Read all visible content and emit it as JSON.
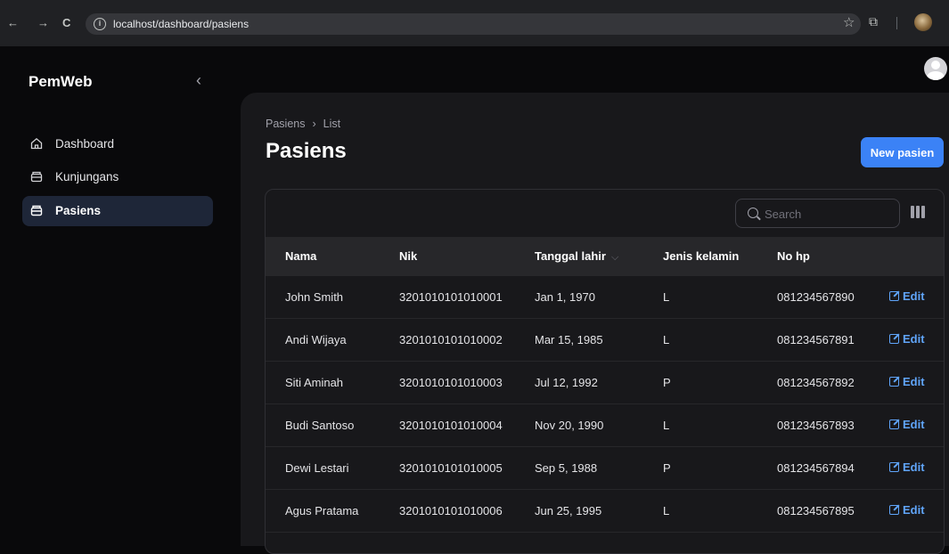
{
  "browser": {
    "back": "←",
    "forward": "→",
    "reload": "C",
    "url": "localhost/dashboard/pasiens"
  },
  "sidebar": {
    "brand": "PemWeb",
    "collapse_icon": "chevron-left-icon",
    "items": [
      {
        "label": "Dashboard",
        "icon": "home-icon",
        "active": false
      },
      {
        "label": "Kunjungans",
        "icon": "inbox-icon",
        "active": false
      },
      {
        "label": "Pasiens",
        "icon": "inbox-icon",
        "active": true
      }
    ]
  },
  "header": {
    "breadcrumb": [
      "Pasiens",
      "List"
    ],
    "title": "Pasiens",
    "new_button": "New pasien"
  },
  "table": {
    "search_placeholder": "Search",
    "columns": [
      "Nama",
      "Nik",
      "Tanggal lahir",
      "Jenis kelamin",
      "No hp"
    ],
    "sorted_column": "Tanggal lahir",
    "edit_label": "Edit",
    "rows": [
      [
        "John Smith",
        "3201010101010001",
        "Jan 1, 1970",
        "L",
        "081234567890"
      ],
      [
        "Andi Wijaya",
        "3201010101010002",
        "Mar 15, 1985",
        "L",
        "081234567891"
      ],
      [
        "Siti Aminah",
        "3201010101010003",
        "Jul 12, 1992",
        "P",
        "081234567892"
      ],
      [
        "Budi Santoso",
        "3201010101010004",
        "Nov 20, 1990",
        "L",
        "081234567893"
      ],
      [
        "Dewi Lestari",
        "3201010101010005",
        "Sep 5, 1988",
        "P",
        "081234567894"
      ],
      [
        "Agus Pratama",
        "3201010101010006",
        "Jun 25, 1995",
        "L",
        "081234567895"
      ]
    ]
  },
  "colors": {
    "accent": "#3b82f6",
    "link": "#60a5fa",
    "active_nav": "#1e2638",
    "panel": "#18181b"
  }
}
